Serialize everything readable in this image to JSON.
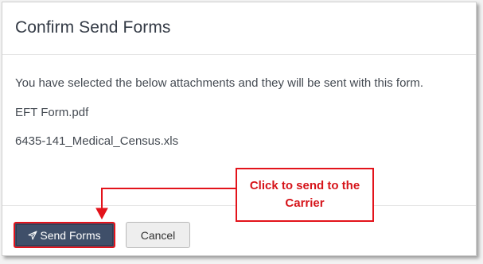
{
  "dialog": {
    "title": "Confirm Send Forms",
    "intro": "You have selected the below attachments and they will be sent with this form.",
    "attachments": [
      "EFT Form.pdf",
      "6435-141_Medical_Census.xls"
    ]
  },
  "footer": {
    "send_label": "Send Forms",
    "send_icon": "paper-plane-icon",
    "cancel_label": "Cancel"
  },
  "annotation": {
    "callout_line1": "Click to send to the",
    "callout_line2": "Carrier",
    "color": "#e3131b"
  },
  "colors": {
    "primary_button": "#3f4f69",
    "highlight": "#e3131b"
  }
}
